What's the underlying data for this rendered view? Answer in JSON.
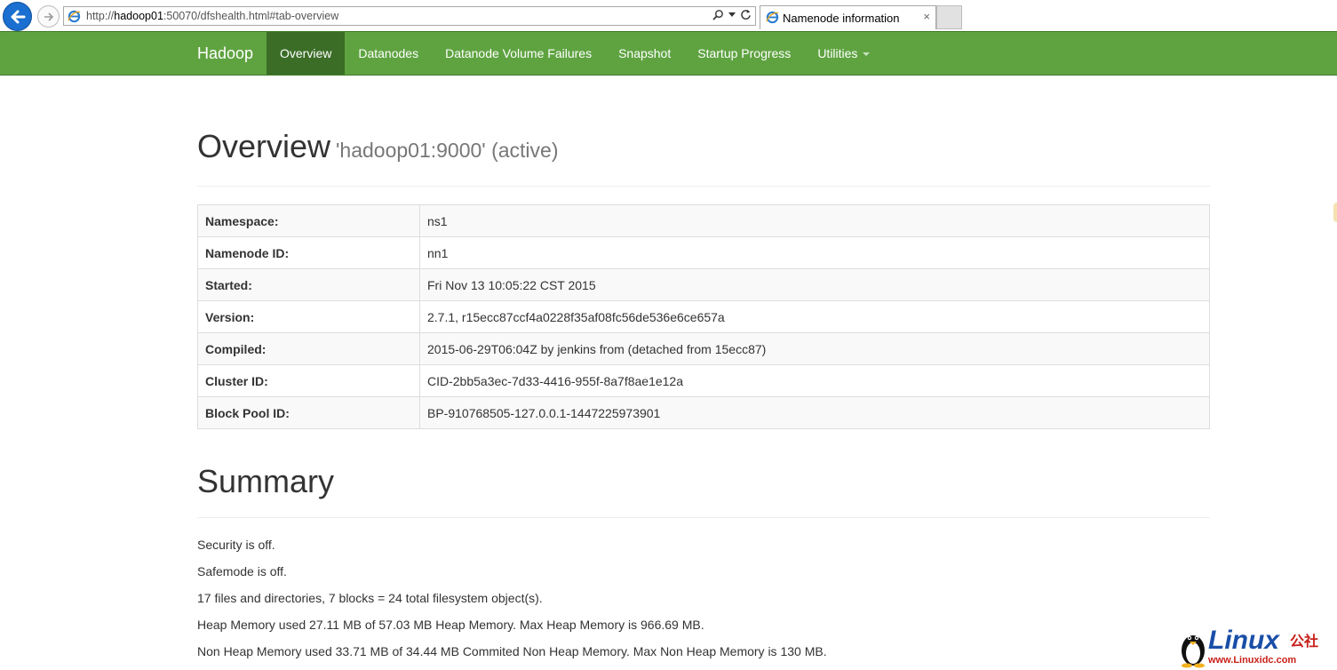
{
  "browser": {
    "url_prefix": "http://",
    "url_host": "hadoop01",
    "url_rest": ":50070/dfshealth.html#tab-overview",
    "tab_title": "Namenode information",
    "tab_close": "×"
  },
  "navbar": {
    "brand": "Hadoop",
    "items": [
      {
        "label": "Overview",
        "active": true
      },
      {
        "label": "Datanodes"
      },
      {
        "label": "Datanode Volume Failures"
      },
      {
        "label": "Snapshot"
      },
      {
        "label": "Startup Progress"
      },
      {
        "label": "Utilities",
        "dropdown": true
      }
    ]
  },
  "overview": {
    "title": "Overview",
    "subtitle": "'hadoop01:9000' (active)",
    "rows": [
      {
        "key": "Namespace:",
        "value": "ns1"
      },
      {
        "key": "Namenode ID:",
        "value": "nn1"
      },
      {
        "key": "Started:",
        "value": "Fri Nov 13 10:05:22 CST 2015"
      },
      {
        "key": "Version:",
        "value": "2.7.1, r15ecc87ccf4a0228f35af08fc56de536e6ce657a"
      },
      {
        "key": "Compiled:",
        "value": "2015-06-29T06:04Z by jenkins from (detached from 15ecc87)"
      },
      {
        "key": "Cluster ID:",
        "value": "CID-2bb5a3ec-7d33-4416-955f-8a7f8ae1e12a"
      },
      {
        "key": "Block Pool ID:",
        "value": "BP-910768505-127.0.0.1-1447225973901"
      }
    ]
  },
  "summary": {
    "title": "Summary",
    "lines": [
      "Security is off.",
      "Safemode is off.",
      "17 files and directories, 7 blocks = 24 total filesystem object(s).",
      "Heap Memory used 27.11 MB of 57.03 MB Heap Memory. Max Heap Memory is 966.69 MB.",
      "Non Heap Memory used 33.71 MB of 34.44 MB Commited Non Heap Memory. Max Non Heap Memory is 130 MB."
    ]
  },
  "watermark": {
    "word": "Linux",
    "cn": "公社",
    "site": "www.Linuxidc.com"
  },
  "colors": {
    "navbar": "#5fa341",
    "navbar_active": "#3b6d27",
    "back_button": "#1a6fd0"
  },
  "icons": {
    "back": "back-arrow-icon",
    "forward": "forward-arrow-icon",
    "ie": "ie-logo-icon",
    "search": "search-icon",
    "refresh": "refresh-icon"
  }
}
